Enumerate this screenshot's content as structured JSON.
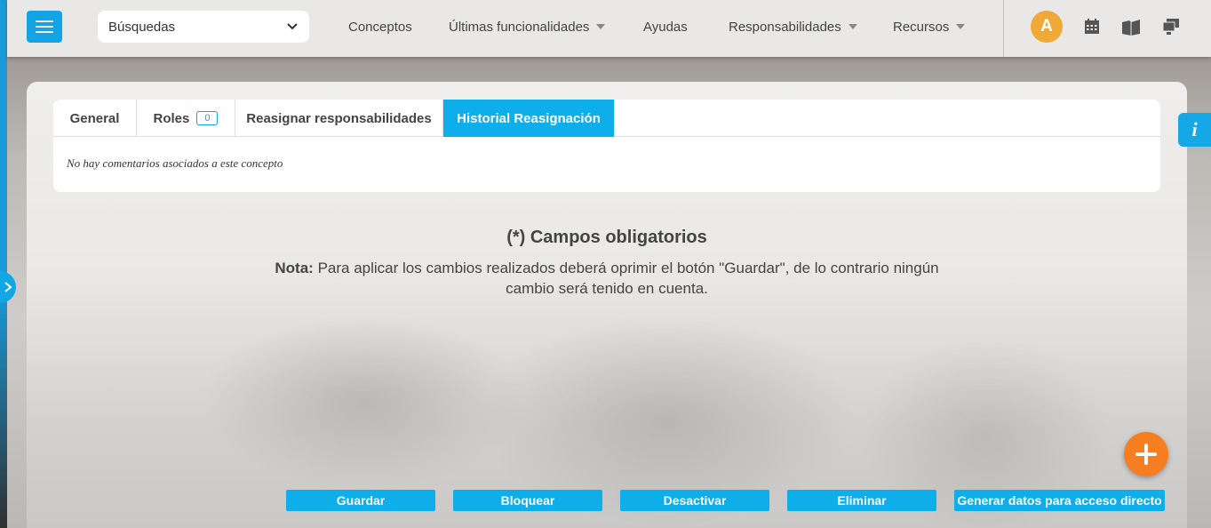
{
  "topbar": {
    "search_select_value": "Búsquedas",
    "nav": [
      {
        "label": "Conceptos",
        "has_caret": false
      },
      {
        "label": "Últimas funcionalidades",
        "has_caret": true
      },
      {
        "label": "Ayudas",
        "has_caret": false
      },
      {
        "label": "Responsabilidades",
        "has_caret": true
      },
      {
        "label": "Recursos",
        "has_caret": true
      }
    ],
    "avatar_letter": "A",
    "icons": [
      "calendar-icon",
      "book-icon",
      "monitor-icon"
    ]
  },
  "tabs": [
    {
      "label": "General",
      "active": false
    },
    {
      "label": "Roles",
      "badge": "0",
      "active": false
    },
    {
      "label": "Reasignar responsabilidades",
      "active": false
    },
    {
      "label": "Historial Reasignación",
      "active": true
    }
  ],
  "empty_message": "No hay comentarios asociados a este concepto",
  "required_title": "(*) Campos obligatorios",
  "note": {
    "label": "Nota:",
    "text": "Para aplicar los cambios realizados deberá oprimir el botón \"Guardar\", de lo contrario ningún cambio será tenido en cuenta."
  },
  "info_tab_label": "i",
  "actions": {
    "save": "Guardar",
    "lock": "Bloquear",
    "deactivate": "Desactivar",
    "delete": "Eliminar",
    "shortcut": "Generar datos para acceso directo"
  },
  "colors": {
    "accent": "#0eaeea",
    "fab": "#f57f20",
    "avatar": "#f0a836"
  }
}
